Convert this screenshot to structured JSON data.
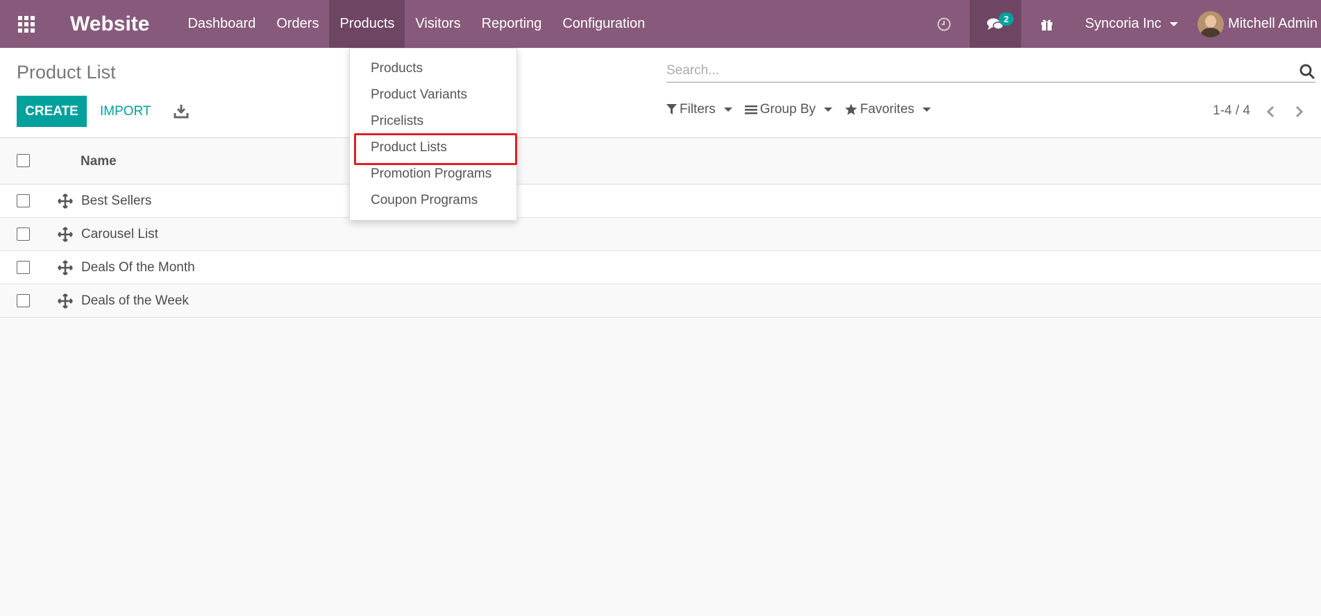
{
  "navbar": {
    "brand": "Website",
    "menu": [
      {
        "label": "Dashboard",
        "active": false
      },
      {
        "label": "Orders",
        "active": false
      },
      {
        "label": "Products",
        "active": true
      },
      {
        "label": "Visitors",
        "active": false
      },
      {
        "label": "Reporting",
        "active": false
      },
      {
        "label": "Configuration",
        "active": false
      }
    ],
    "messages_count": "2",
    "company": "Syncoria Inc",
    "user": "Mitchell Admin"
  },
  "control_panel": {
    "title": "Product List",
    "create_label": "CREATE",
    "import_label": "IMPORT",
    "search_placeholder": "Search...",
    "filters_label": "Filters",
    "groupby_label": "Group By",
    "favorites_label": "Favorites",
    "pager": "1-4 / 4"
  },
  "list": {
    "column_name": "Name",
    "rows": [
      {
        "name": "Best Sellers"
      },
      {
        "name": "Carousel List"
      },
      {
        "name": "Deals Of the Month"
      },
      {
        "name": "Deals of the Week"
      }
    ]
  },
  "products_dropdown": {
    "items": [
      {
        "label": "Products"
      },
      {
        "label": "Product Variants"
      },
      {
        "label": "Pricelists"
      },
      {
        "label": "Product Lists"
      },
      {
        "label": "Promotion Programs"
      },
      {
        "label": "Coupon Programs"
      }
    ],
    "highlighted": "Product Lists"
  },
  "colors": {
    "navbar": "#875a7b",
    "navbar_active": "#6e4664",
    "primary": "#00a09d",
    "highlight_border": "#e01f26"
  }
}
